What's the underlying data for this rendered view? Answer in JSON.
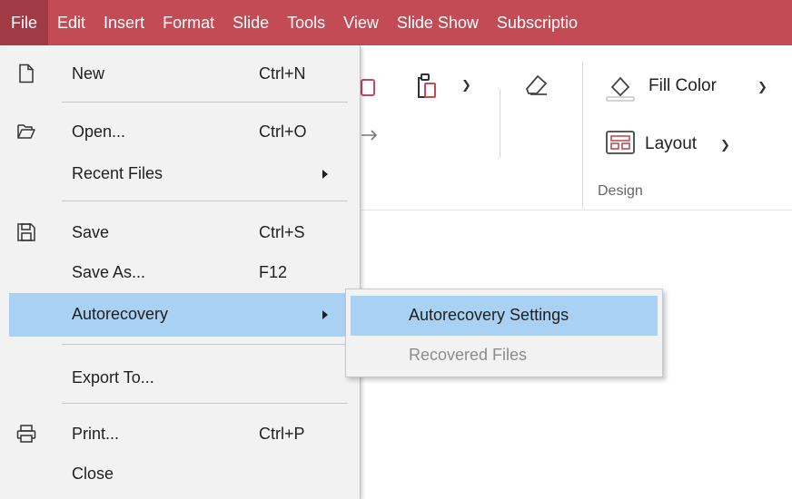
{
  "menubar": {
    "items": [
      "File",
      "Edit",
      "Insert",
      "Format",
      "Slide",
      "Tools",
      "View",
      "Slide Show",
      "Subscriptio"
    ]
  },
  "ribbon": {
    "fill_color": "Fill Color",
    "layout": "Layout",
    "group_design": "Design"
  },
  "file_menu": {
    "new": {
      "label": "New",
      "shortcut": "Ctrl+N",
      "icon": "new-document-icon"
    },
    "open": {
      "label": "Open...",
      "shortcut": "Ctrl+O",
      "icon": "folder-open-icon"
    },
    "recent": {
      "label": "Recent Files"
    },
    "save": {
      "label": "Save",
      "shortcut": "Ctrl+S",
      "icon": "save-icon"
    },
    "save_as": {
      "label": "Save As...",
      "shortcut": "F12"
    },
    "autorecovery": {
      "label": "Autorecovery"
    },
    "export": {
      "label": "Export To..."
    },
    "print": {
      "label": "Print...",
      "shortcut": "Ctrl+P",
      "icon": "printer-icon"
    },
    "close": {
      "label": "Close"
    }
  },
  "autorecovery_submenu": {
    "settings": "Autorecovery Settings",
    "recovered": "Recovered Files"
  },
  "colors": {
    "menubar": "#c24b55",
    "menubar_active": "#a13a44",
    "highlight": "#a8d1f3",
    "menu_bg": "#f2f2f2"
  }
}
